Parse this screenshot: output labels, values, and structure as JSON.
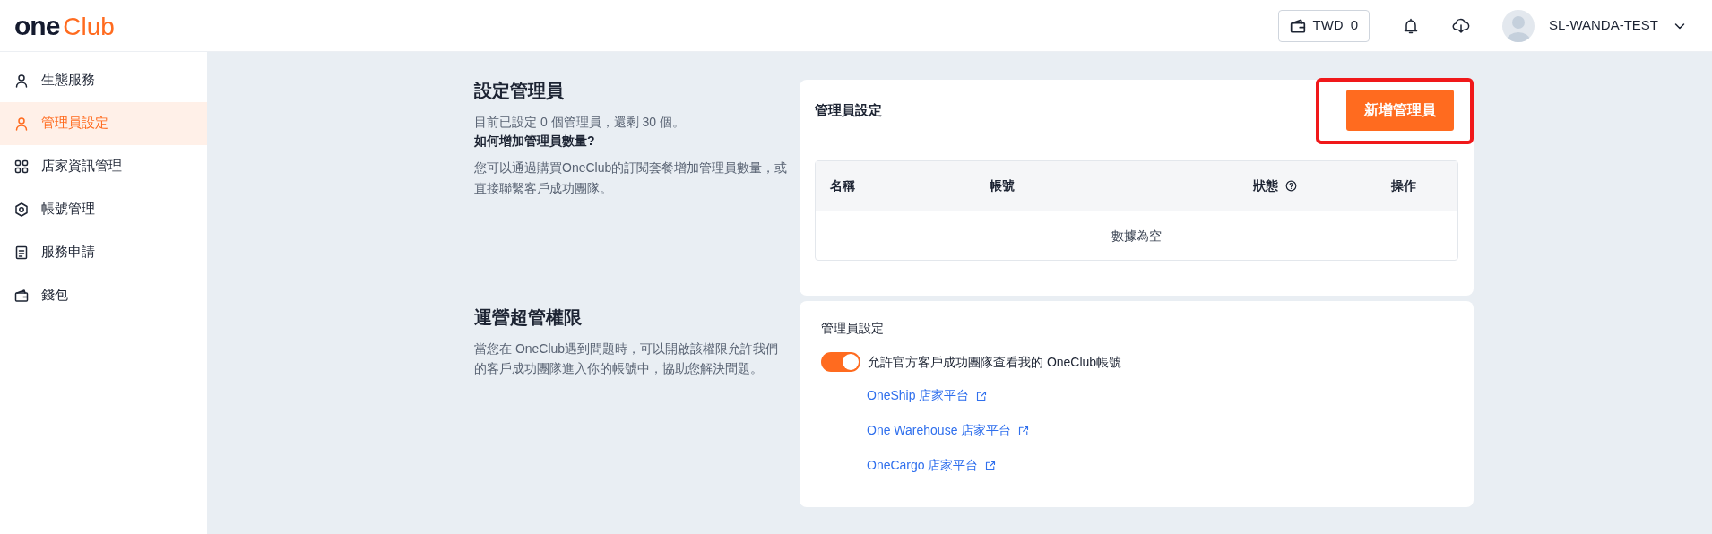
{
  "header": {
    "logo": {
      "part_1": "one",
      "part_2": "Club"
    },
    "wallet": {
      "currency": "TWD",
      "amount": "0"
    },
    "user": {
      "name": "SL-WANDA-TEST"
    }
  },
  "sidebar": {
    "items": [
      {
        "label": "生態服務",
        "selected": false
      },
      {
        "label": "管理員設定",
        "selected": true
      },
      {
        "label": "店家資訊管理",
        "selected": false
      },
      {
        "label": "帳號管理",
        "selected": false
      },
      {
        "label": "服務申請",
        "selected": false
      },
      {
        "label": "錢包",
        "selected": false
      }
    ]
  },
  "admin_section": {
    "title": "設定管理員",
    "summary": "目前已設定 0 個管理員，還剩 30 個。",
    "question": "如何增加管理員數量?",
    "answer": "您可以通過購買OneClub的訂閱套餐增加管理員數量，或直接聯繫客戶成功團隊。",
    "card": {
      "title": "管理員設定",
      "button": "新增管理員",
      "highlighted": true,
      "table": {
        "columns": [
          "名稱",
          "帳號",
          "狀態",
          "操作"
        ],
        "empty_text": "數據為空"
      }
    }
  },
  "support_section": {
    "title": "運營超管權限",
    "description": "當您在 OneClub遇到問題時，可以開啟該權限允許我們的客戶成功團隊進入你的帳號中，協助您解決問題。",
    "card": {
      "title": "管理員設定",
      "toggle": {
        "label": "允許官方客戶成功團隊查看我的 OneClub帳號",
        "on": true
      },
      "links": [
        "OneShip 店家平台",
        "One Warehouse 店家平台",
        "OneCargo 店家平台"
      ]
    }
  }
}
